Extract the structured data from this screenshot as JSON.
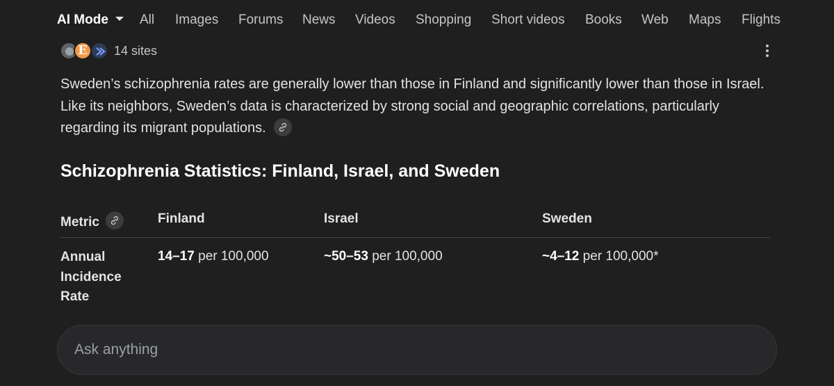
{
  "tabs": [
    {
      "label": "AI Mode",
      "active": true
    },
    {
      "label": "All"
    },
    {
      "label": "Images"
    },
    {
      "label": "Forums"
    },
    {
      "label": "News"
    },
    {
      "label": "Videos"
    },
    {
      "label": "Shopping"
    },
    {
      "label": "Short videos"
    },
    {
      "label": "Books"
    },
    {
      "label": "Web"
    },
    {
      "label": "Maps"
    },
    {
      "label": "Flights"
    }
  ],
  "sources": {
    "count_label": "14 sites",
    "icon_b_glyph": "E",
    "icons": [
      "source-favicon",
      "source-favicon",
      "source-favicon"
    ]
  },
  "answer": {
    "paragraph": "Sweden’s schizophrenia rates are generally lower than those in Finland and significantly lower than those in Israel. Like its neighbors, Sweden’s data is characterized by strong social and geographic correlations, particularly regarding its migrant populations."
  },
  "section": {
    "heading": "Schizophrenia Statistics: Finland, Israel, and Sweden"
  },
  "table": {
    "headers": [
      "Metric",
      "Finland",
      "Israel",
      "Sweden"
    ],
    "rows": [
      {
        "metric": "Annual Incidence Rate",
        "finland": {
          "value": "14–17",
          "unit": " per 100,000"
        },
        "israel": {
          "value": "~50–53",
          "unit": " per 100,000"
        },
        "sweden": {
          "value": "~4–12",
          "unit": " per 100,000*"
        }
      }
    ]
  },
  "ask": {
    "placeholder": "Ask anything"
  },
  "colors": {
    "background": "#1f1f1f",
    "text": "#e3e3e3",
    "muted": "#c4c7c5",
    "divider": "#444746"
  }
}
